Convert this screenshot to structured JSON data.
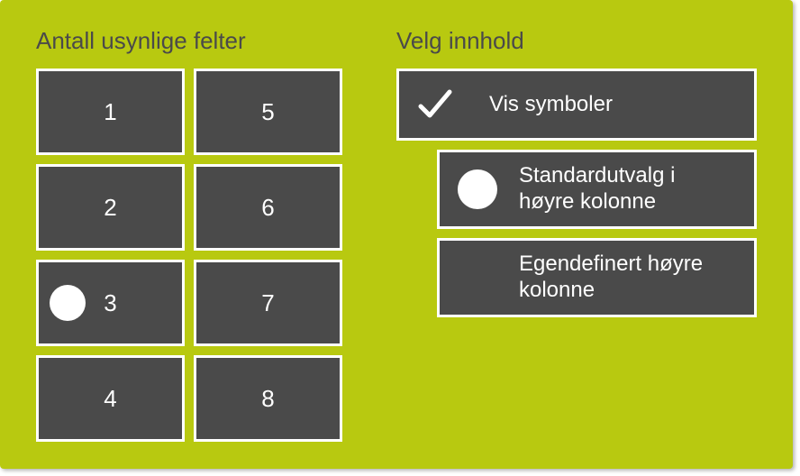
{
  "left": {
    "title": "Antall usynlige felter",
    "buttons": [
      "1",
      "2",
      "3",
      "4",
      "5",
      "6",
      "7",
      "8"
    ],
    "selected": "3"
  },
  "right": {
    "title": "Velg innhold",
    "items": [
      {
        "label": "Vis symboler",
        "type": "check",
        "selected": true
      },
      {
        "label": "Standardutvalg i høyre kolonne",
        "type": "radio",
        "selected": true
      },
      {
        "label": "Egendefinert høyre kolonne",
        "type": "radio",
        "selected": false
      }
    ]
  },
  "colors": {
    "background": "#b8c910",
    "button": "#4a4a4a",
    "border": "#ffffff",
    "text": "#ffffff",
    "title": "#4a4a4a"
  }
}
